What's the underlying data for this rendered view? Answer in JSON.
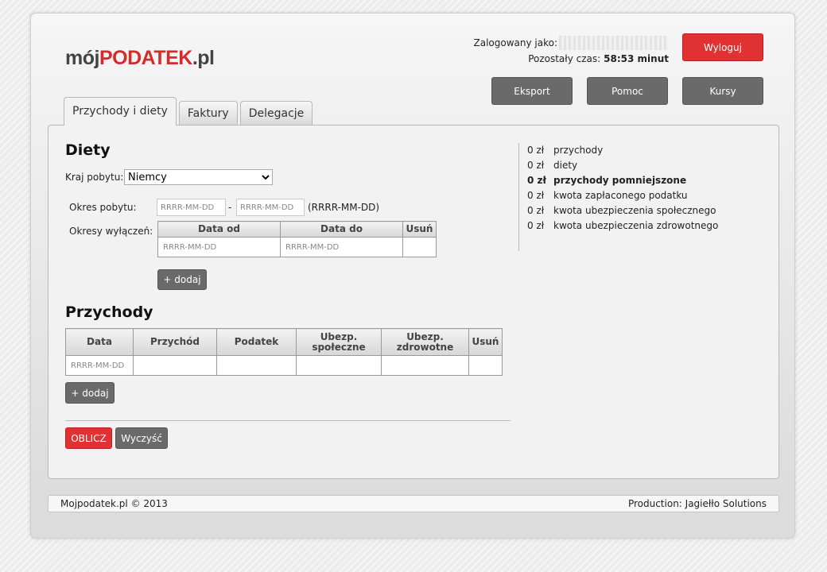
{
  "logo": {
    "part1": "mój",
    "part2": "PODATEK",
    "part3": ".pl"
  },
  "header": {
    "logged_as_label": "Zalogowany jako:",
    "time_left_label": "Pozostały czas:",
    "time_left_value": "58:53 minut",
    "logout_label": "Wyloguj",
    "buttons": [
      "Eksport",
      "Pomoc",
      "Kursy"
    ]
  },
  "tabs": [
    {
      "label": "Przychody i diety",
      "active": true
    },
    {
      "label": "Faktury",
      "active": false
    },
    {
      "label": "Delegacje",
      "active": false
    }
  ],
  "diety": {
    "title": "Diety",
    "country_label": "Kraj pobytu:",
    "country_selected": "Niemcy",
    "stay_period_label": "Okres pobytu:",
    "date_placeholder": "RRRR-MM-DD",
    "date_separator": "-",
    "date_format_hint": "(RRRR-MM-DD)",
    "exclusions_label": "Okresy wyłączeń:",
    "exclusions_columns": [
      "Data od",
      "Data do",
      "Usuń"
    ],
    "add_label": "+ dodaj"
  },
  "przychody": {
    "title": "Przychody",
    "columns": [
      "Data",
      "Przychód",
      "Podatek",
      "Ubezp. społeczne",
      "Ubezp. zdrowotne",
      "Usuń"
    ],
    "date_placeholder": "RRRR-MM-DD",
    "add_label": "+ dodaj"
  },
  "actions": {
    "calculate_label": "OBLICZ",
    "clear_label": "Wyczyść"
  },
  "summary": [
    {
      "value": "0 zł",
      "label": "przychody",
      "bold": false
    },
    {
      "value": "0 zł",
      "label": "diety",
      "bold": false
    },
    {
      "value": "0 zł",
      "label": "przychody pomniejszone",
      "bold": true
    },
    {
      "value": "0 zł",
      "label": "kwota zapłaconego podatku",
      "bold": false
    },
    {
      "value": "0 zł",
      "label": "kwota ubezpieczenia społecznego",
      "bold": false
    },
    {
      "value": "0 zł",
      "label": "kwota ubezpieczenia zdrowotnego",
      "bold": false
    }
  ],
  "footer": {
    "left": "Mojpodatek.pl © 2013",
    "right": "Production: Jagiełło Solutions"
  },
  "colors": {
    "accent_red": "#e03232",
    "button_gray": "#6a6a6a",
    "logo_red": "#d52b2b"
  }
}
